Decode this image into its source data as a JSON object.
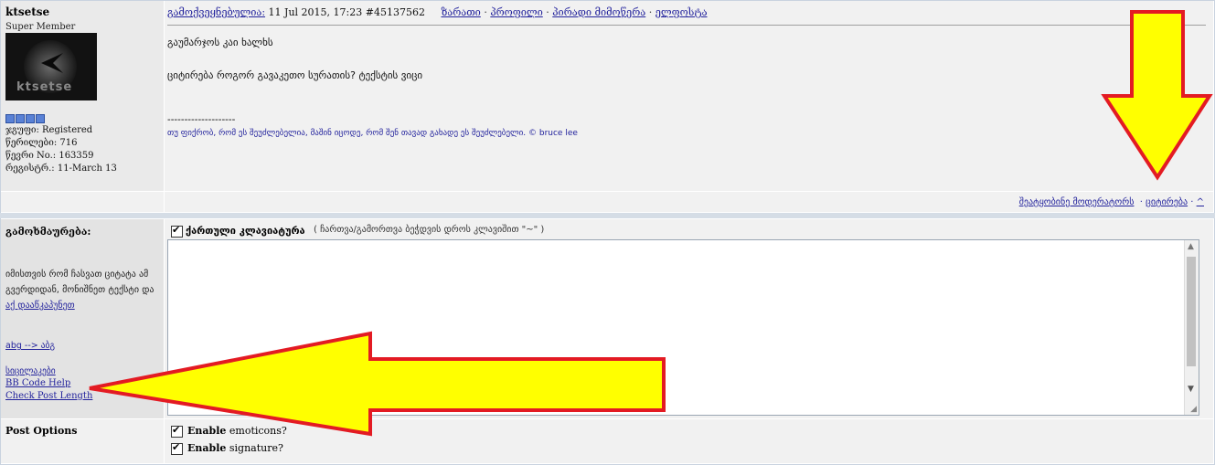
{
  "post": {
    "username": "ktsetse",
    "user_title": "Super Member",
    "avatar_text": "ktsetse",
    "info": [
      "ჯგუფი: Registered",
      "წერილები: 716",
      "წევრი No.: 163359",
      "რეგისტრ.: 11-March 13"
    ],
    "posted_label": "გამოქვეყნებულია:",
    "posted_date": "11 Jul 2015, 17:23",
    "post_number": "#45137562",
    "header_links": [
      "ზარათი",
      "პროფილი",
      "პირადი მიმოწერა",
      "ელფოსტა"
    ],
    "body_lines": [
      "გაუმარჯოს კაი ხალხს",
      "ციტირება როგორ გავაკეთო სურათის? ტექსტის ვიცი"
    ],
    "sig_dashes": "--------------------",
    "signature": "თუ ფიქრობ, რომ ეს შეუძლებელია, მაშინ იცოდე, რომ შენ თავად გახადე ეს შეუძლებელი. © bruce lee",
    "footer_report": "შეატყობინე მოდერატორს",
    "footer_quote": "ციტირება",
    "footer_top": "^"
  },
  "reply": {
    "label": "გამოხმაურება:",
    "help_text": "იმისთვის რომ ჩასვათ ციტატა ამ გვერდიდან, მონიშნეთ ტექსტი და",
    "help_link": "აქ დააწკაპუნეთ",
    "translit_link": "abg --> აბგ",
    "links": [
      "სიცილაკები",
      "BB Code Help",
      "Check Post Length"
    ],
    "keyboard_label": "ქართული კლავიატურა",
    "keyboard_note": "( ჩართვა/გამორთვა ბეჭდვის დროს კლავიშით \"~\" )",
    "textarea_value": ""
  },
  "options": {
    "label": "Post Options",
    "items": [
      {
        "bold": "Enable",
        "rest": " emoticons?"
      },
      {
        "bold": "Enable",
        "rest": " signature?"
      }
    ]
  },
  "colors": {
    "arrow_fill": "#ffff00",
    "arrow_stroke": "#e31b23",
    "link": "#22229c"
  }
}
